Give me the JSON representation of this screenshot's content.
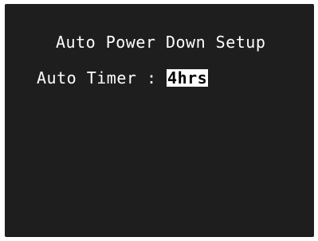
{
  "menu": {
    "title": "Auto Power Down Setup",
    "timer": {
      "label": "Auto Timer :",
      "value": "4hrs"
    }
  }
}
